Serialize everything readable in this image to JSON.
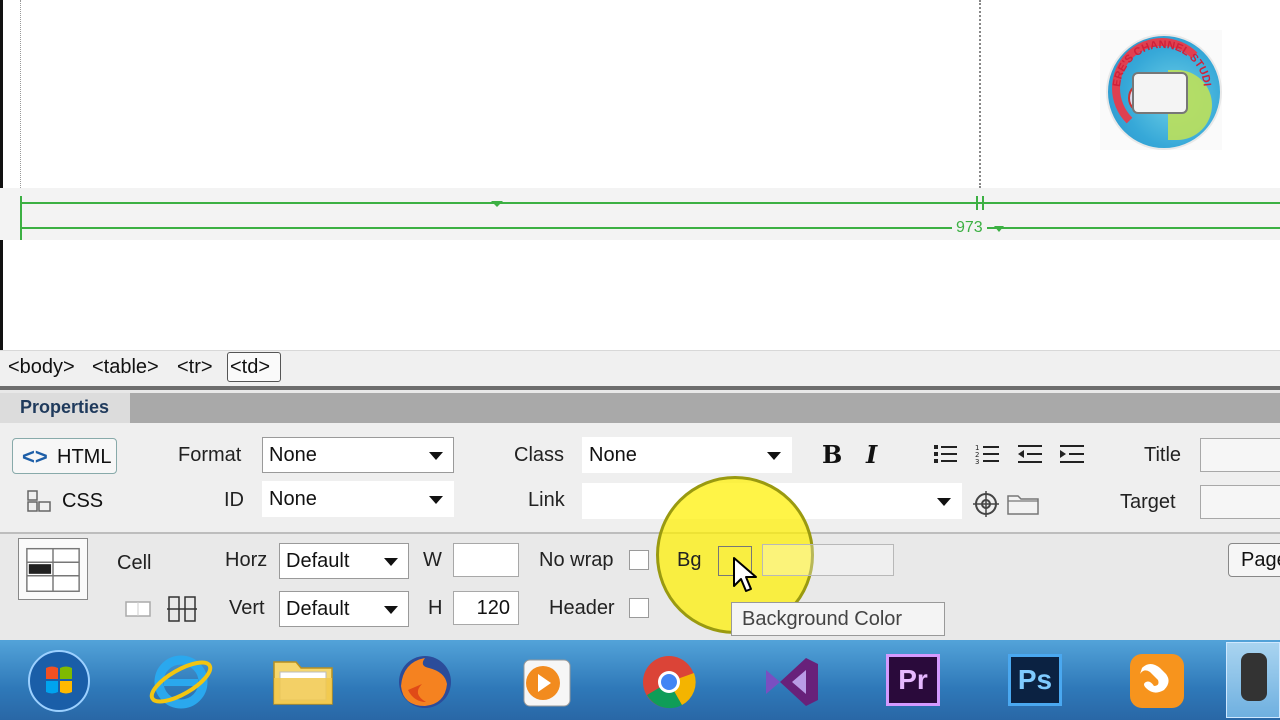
{
  "design_view": {
    "logo_text": "DERE'S CHANNEL STUDIO",
    "table_width": "973"
  },
  "tag_selector": {
    "tags": [
      "<body>",
      "<table>",
      "<tr>",
      "<td>"
    ]
  },
  "properties": {
    "tab_label": "Properties",
    "mode_html": "HTML",
    "mode_css": "CSS",
    "format_label": "Format",
    "format_value": "None",
    "id_label": "ID",
    "id_value": "None",
    "class_label": "Class",
    "class_value": "None",
    "link_label": "Link",
    "link_value": "",
    "title_label": "Title",
    "target_label": "Target",
    "bold_label": "B",
    "italic_label": "I",
    "cell_label": "Cell",
    "horz_label": "Horz",
    "horz_value": "Default",
    "vert_label": "Vert",
    "vert_value": "Default",
    "w_label": "W",
    "w_value": "",
    "h_label": "H",
    "h_value": "120",
    "nowrap_label": "No wrap",
    "header_label": "Header",
    "bg_label": "Bg",
    "tooltip": "Background Color",
    "page_button": "Page"
  },
  "taskbar": {
    "apps": [
      "start-orb-icon",
      "internet-explorer-icon",
      "file-explorer-icon",
      "firefox-icon",
      "media-player-icon",
      "chrome-icon",
      "visual-studio-icon",
      "premiere-pro-icon",
      "photoshop-icon",
      "uc-browser-icon"
    ],
    "premiere_label": "Pr",
    "photoshop_label": "Ps"
  },
  "colors": {
    "guide_green": "#3cb043",
    "highlight_yellow": "#fff000",
    "taskbar_blue": "#2f79b9"
  }
}
